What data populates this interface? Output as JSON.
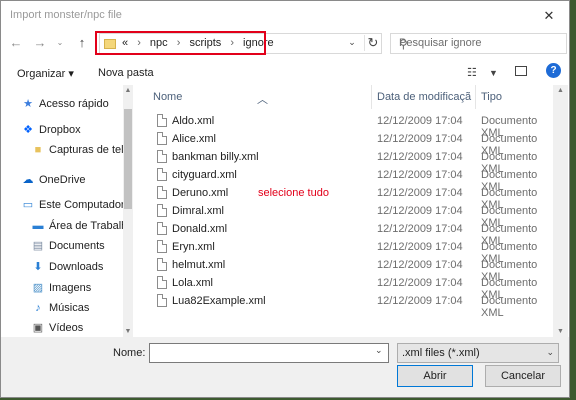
{
  "window": {
    "title": "Import monster/npc file"
  },
  "address": {
    "crumbs": [
      "npc",
      "scripts",
      "ignore"
    ],
    "prefix": "«"
  },
  "search": {
    "placeholder": "Pesquisar ignore"
  },
  "toolbar": {
    "organize": "Organizar ▾",
    "new_folder": "Nova pasta"
  },
  "sidebar": {
    "items": [
      {
        "label": "Acesso rápido",
        "icon": "star-icon"
      },
      {
        "label": "Dropbox",
        "icon": "dropbox-icon"
      },
      {
        "label": "Capturas de tela",
        "icon": "folder-icon"
      },
      {
        "label": "OneDrive",
        "icon": "cloud-icon"
      },
      {
        "label": "Este Computador",
        "icon": "computer-icon"
      },
      {
        "label": "Área de Trabalho",
        "icon": "desktop-icon"
      },
      {
        "label": "Documents",
        "icon": "documents-icon"
      },
      {
        "label": "Downloads",
        "icon": "download-icon"
      },
      {
        "label": "Imagens",
        "icon": "images-icon"
      },
      {
        "label": "Músicas",
        "icon": "music-icon"
      },
      {
        "label": "Vídeos",
        "icon": "video-icon"
      }
    ]
  },
  "columns": {
    "name": "Nome",
    "date": "Data de modificaçã",
    "type": "Tipo"
  },
  "files": [
    {
      "name": "Aldo.xml",
      "date": "12/12/2009 17:04",
      "type": "Documento XML"
    },
    {
      "name": "Alice.xml",
      "date": "12/12/2009 17:04",
      "type": "Documento XML"
    },
    {
      "name": "bankman billy.xml",
      "date": "12/12/2009 17:04",
      "type": "Documento XML"
    },
    {
      "name": "cityguard.xml",
      "date": "12/12/2009 17:04",
      "type": "Documento XML"
    },
    {
      "name": "Deruno.xml",
      "date": "12/12/2009 17:04",
      "type": "Documento XML"
    },
    {
      "name": "Dimral.xml",
      "date": "12/12/2009 17:04",
      "type": "Documento XML"
    },
    {
      "name": "Donald.xml",
      "date": "12/12/2009 17:04",
      "type": "Documento XML"
    },
    {
      "name": "Eryn.xml",
      "date": "12/12/2009 17:04",
      "type": "Documento XML"
    },
    {
      "name": "helmut.xml",
      "date": "12/12/2009 17:04",
      "type": "Documento XML"
    },
    {
      "name": "Lola.xml",
      "date": "12/12/2009 17:04",
      "type": "Documento XML"
    },
    {
      "name": "Lua82Example.xml",
      "date": "12/12/2009 17:04",
      "type": "Documento XML"
    }
  ],
  "annotation": "selecione tudo",
  "footer": {
    "name_label": "Nome:",
    "name_value": "",
    "filter": ".xml files (*.xml)",
    "open": "Abrir",
    "cancel": "Cancelar"
  },
  "colors": {
    "highlight": "#e2001a",
    "accent": "#0078d7"
  }
}
